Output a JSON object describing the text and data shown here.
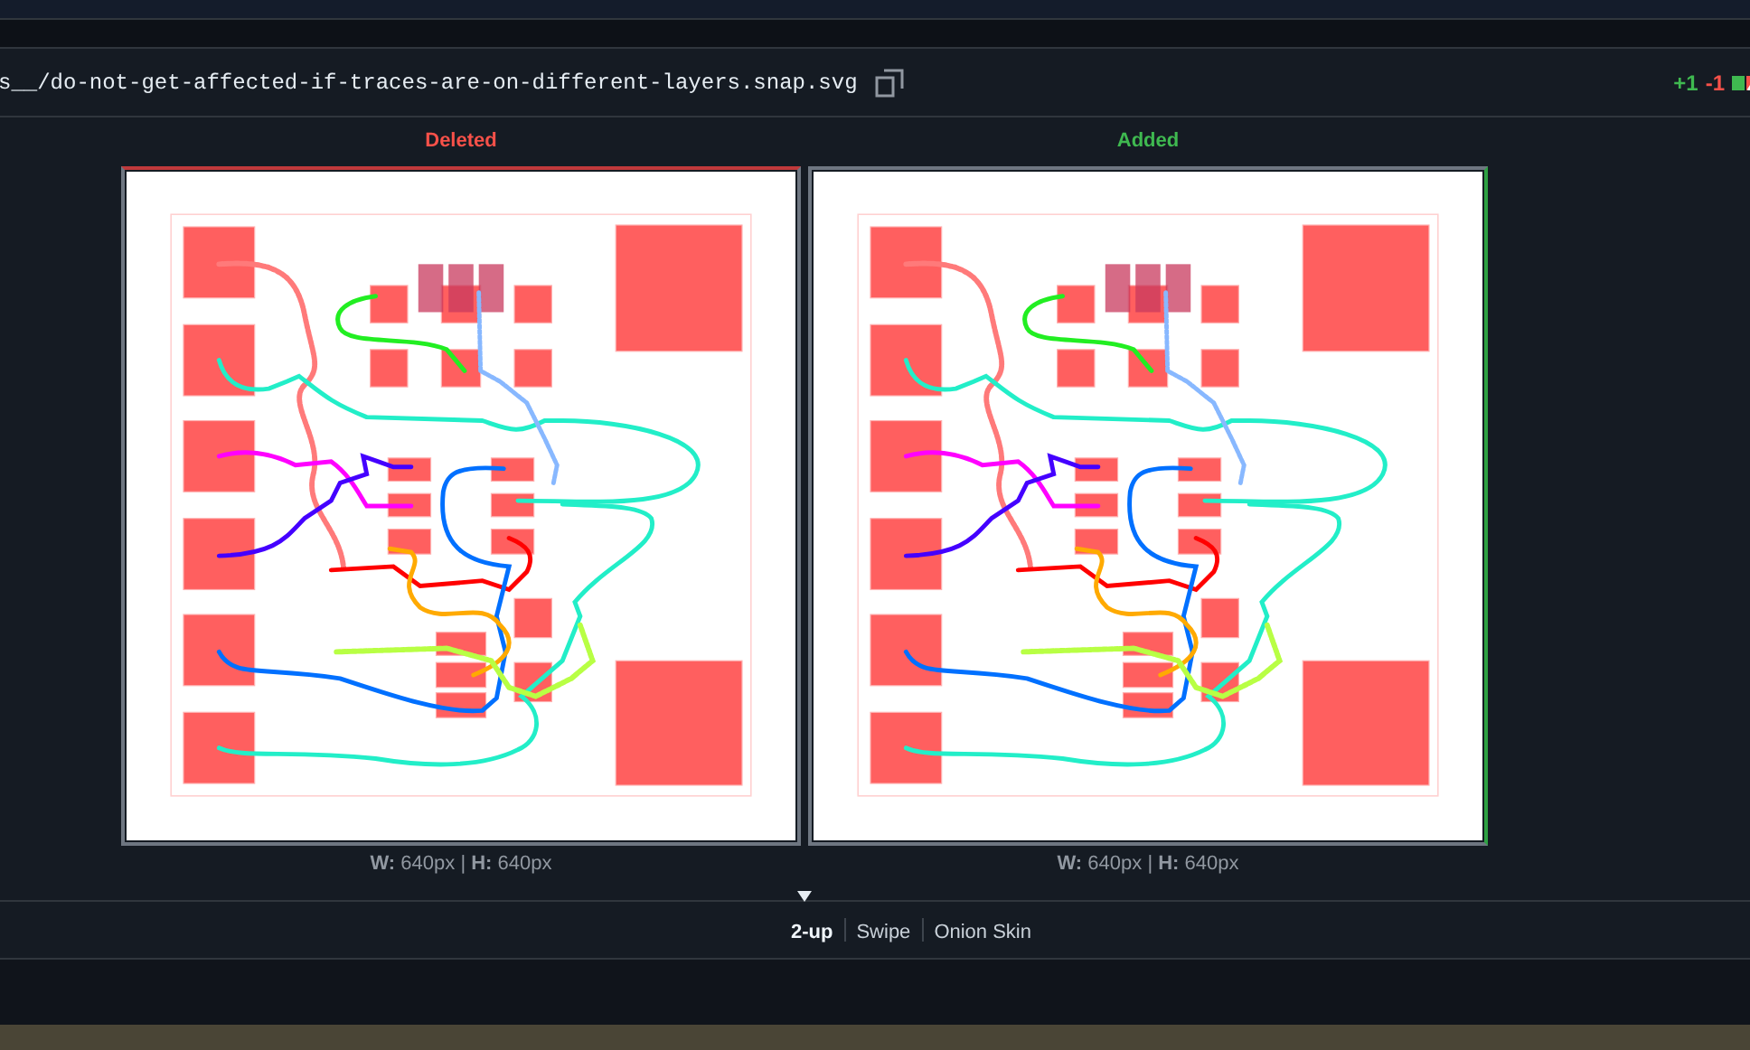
{
  "file_header": {
    "path": "s__/do-not-get-affected-if-traces-are-on-different-layers.snap.svg",
    "additions": "+1",
    "deletions": "-1"
  },
  "panes": [
    {
      "kind": "deleted",
      "label": "Deleted",
      "dimensions": "**W:** 640px | **H:** 640px"
    },
    {
      "kind": "added",
      "label": "Added",
      "dimensions": "**W:** 640px | **H:** 640px"
    }
  ],
  "view_modes": [
    {
      "label": "2-up",
      "selected": true
    },
    {
      "label": "Swipe",
      "selected": false
    },
    {
      "label": "Onion Skin",
      "selected": false
    }
  ]
}
